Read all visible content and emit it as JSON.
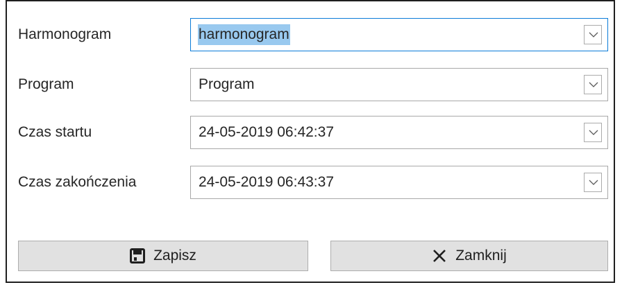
{
  "form": {
    "fields": [
      {
        "label": "Harmonogram",
        "value": "harmonogram"
      },
      {
        "label": "Program",
        "value": "Program"
      },
      {
        "label": "Czas startu",
        "value": "24-05-2019 06:42:37"
      },
      {
        "label": "Czas zakończenia",
        "value": "24-05-2019 06:43:37"
      }
    ]
  },
  "buttons": {
    "save": {
      "label": "Zapisz",
      "icon": "save-icon"
    },
    "close": {
      "label": "Zamknij",
      "icon": "close-icon"
    }
  },
  "colors": {
    "focus_border": "#0a7bd8",
    "selection": "#99c9ef",
    "button_bg": "#e1e1e1"
  }
}
